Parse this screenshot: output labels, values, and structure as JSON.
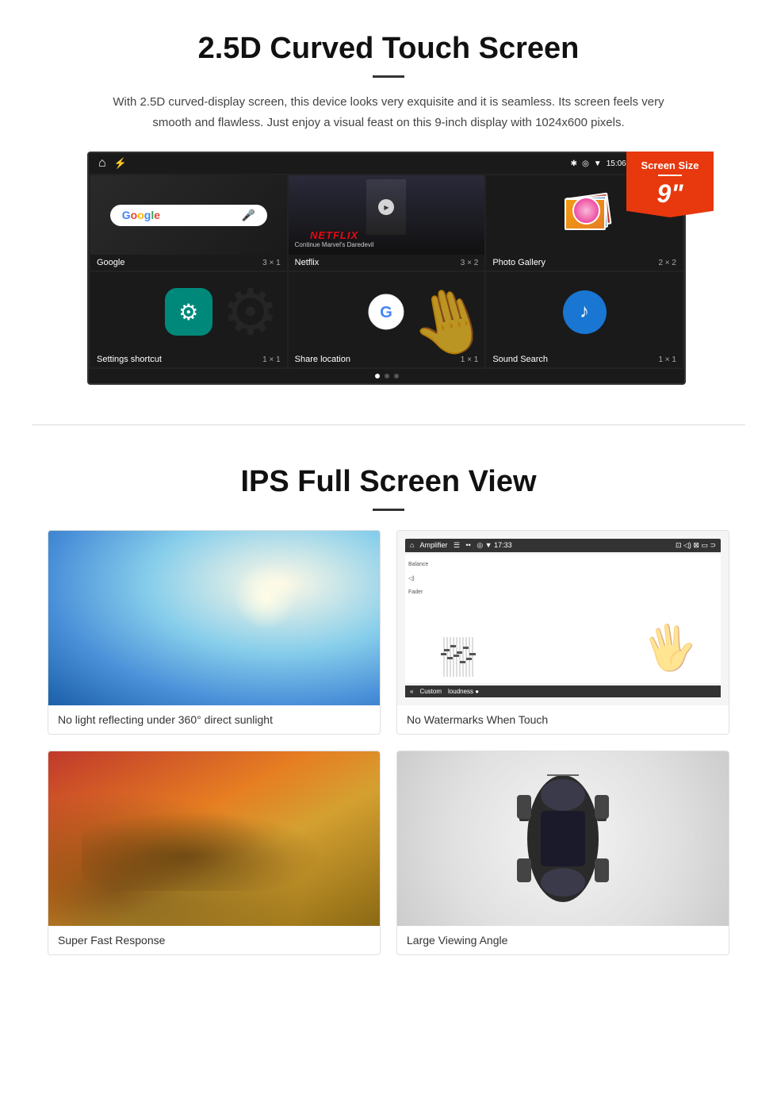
{
  "section1": {
    "title": "2.5D Curved Touch Screen",
    "description": "With 2.5D curved-display screen, this device looks very exquisite and it is seamless. Its screen feels very smooth and flawless. Just enjoy a visual feast on this 9-inch display with 1024x600 pixels.",
    "badge": {
      "label": "Screen Size",
      "size": "9\""
    },
    "status_bar": {
      "time": "15:06"
    },
    "apps": [
      {
        "name": "Google",
        "grid": "3 × 1"
      },
      {
        "name": "Netflix",
        "grid": "3 × 2"
      },
      {
        "name": "Photo Gallery",
        "grid": "2 × 2"
      },
      {
        "name": "Settings shortcut",
        "grid": "1 × 1"
      },
      {
        "name": "Share location",
        "grid": "1 × 1"
      },
      {
        "name": "Sound Search",
        "grid": "1 × 1"
      }
    ],
    "netflix_text": "NETFLIX",
    "netflix_sub": "Continue Marvel's Daredevil"
  },
  "section2": {
    "title": "IPS Full Screen View",
    "features": [
      {
        "id": "sunlight",
        "caption": "No light reflecting under 360° direct sunlight"
      },
      {
        "id": "amplifier",
        "caption": "No Watermarks When Touch"
      },
      {
        "id": "cheetah",
        "caption": "Super Fast Response"
      },
      {
        "id": "car",
        "caption": "Large Viewing Angle"
      }
    ]
  }
}
